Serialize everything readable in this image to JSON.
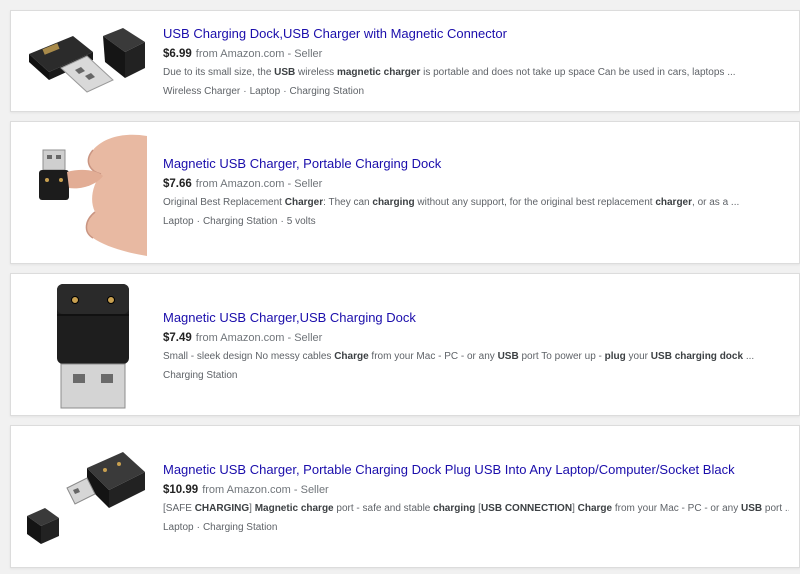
{
  "results": [
    {
      "title": "USB Charging Dock,USB Charger with Magnetic Connector",
      "price": "$6.99",
      "source": "from Amazon.com - Seller",
      "description": [
        {
          "t": "Due to its small size, the ",
          "b": false
        },
        {
          "t": "USB",
          "b": true
        },
        {
          "t": " wireless ",
          "b": false
        },
        {
          "t": "magnetic charger",
          "b": true
        },
        {
          "t": " is portable and does not take up space Can be used in cars, laptops ...",
          "b": false
        }
      ],
      "tags": [
        "Wireless Charger",
        "Laptop",
        "Charging Station"
      ],
      "image": "usb-dock-with-cap-image"
    },
    {
      "title": "Magnetic USB Charger, Portable Charging Dock",
      "price": "$7.66",
      "source": "from Amazon.com - Seller",
      "description": [
        {
          "t": "Original Best Replacement ",
          "b": false
        },
        {
          "t": "Charger",
          "b": true
        },
        {
          "t": ": They can ",
          "b": false
        },
        {
          "t": "charging",
          "b": true
        },
        {
          "t": " without any support, for the original best replacement ",
          "b": false
        },
        {
          "t": "charger",
          "b": true
        },
        {
          "t": ", or as a ...",
          "b": false
        }
      ],
      "tags": [
        "Laptop",
        "Charging Station",
        "5 volts"
      ],
      "image": "hand-holding-charger-image"
    },
    {
      "title": "Magnetic USB Charger,USB Charging Dock",
      "price": "$7.49",
      "source": "from Amazon.com - Seller",
      "description": [
        {
          "t": "Small - sleek design No messy cables ",
          "b": false
        },
        {
          "t": "Charge",
          "b": true
        },
        {
          "t": " from your Mac - PC - or any ",
          "b": false
        },
        {
          "t": "USB",
          "b": true
        },
        {
          "t": " port To power up - ",
          "b": false
        },
        {
          "t": "plug",
          "b": true
        },
        {
          "t": " your ",
          "b": false
        },
        {
          "t": "USB charging dock",
          "b": true
        },
        {
          "t": " ...",
          "b": false
        }
      ],
      "tags": [
        "Charging Station"
      ],
      "image": "vertical-usb-charger-image"
    },
    {
      "title": "Magnetic USB Charger, Portable Charging Dock Plug USB Into Any Laptop/Computer/Socket Black",
      "price": "$10.99",
      "source": "from Amazon.com - Seller",
      "description": [
        {
          "t": "[SAFE ",
          "b": false
        },
        {
          "t": "CHARGING",
          "b": true
        },
        {
          "t": "] ",
          "b": false
        },
        {
          "t": "Magnetic charge",
          "b": true
        },
        {
          "t": " port - safe and stable ",
          "b": false
        },
        {
          "t": "charging",
          "b": true
        },
        {
          "t": " [",
          "b": false
        },
        {
          "t": "USB CONNECTION",
          "b": true
        },
        {
          "t": "] ",
          "b": false
        },
        {
          "t": "Charge",
          "b": true
        },
        {
          "t": " from your Mac - PC - or any ",
          "b": false
        },
        {
          "t": "USB",
          "b": true
        },
        {
          "t": " port ...",
          "b": false
        }
      ],
      "tags": [
        "Laptop",
        "Charging Station"
      ],
      "image": "angled-usb-charger-image"
    }
  ]
}
